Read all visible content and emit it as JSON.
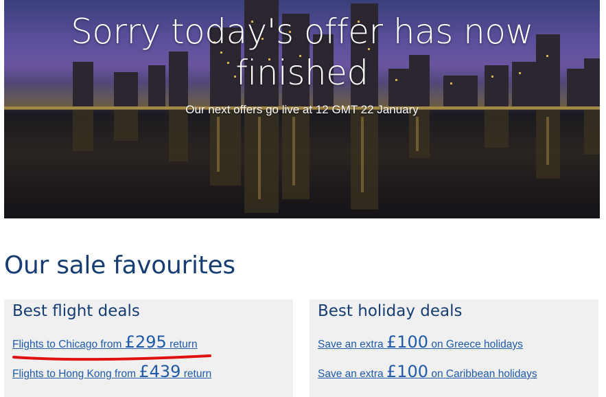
{
  "hero": {
    "title": "Sorry today's offer has now finished",
    "subtitle": "Our next offers go live at 12 GMT 22 January"
  },
  "section": {
    "title": "Our sale favourites"
  },
  "cards": {
    "flight": {
      "title": "Best flight deals",
      "deals": [
        {
          "prefix": "Flights to Chicago from ",
          "price": "£295",
          "suffix": " return"
        },
        {
          "prefix": "Flights to Hong Kong from ",
          "price": "£439",
          "suffix": " return"
        }
      ]
    },
    "holiday": {
      "title": "Best holiday deals",
      "deals": [
        {
          "prefix": "Save an extra ",
          "price": "£100",
          "suffix": " on Greece holidays"
        },
        {
          "prefix": "Save an extra ",
          "price": "£100",
          "suffix": " on Caribbean holidays"
        }
      ]
    }
  },
  "colors": {
    "heading": "#163e72",
    "link": "#1e5aa8",
    "card_bg": "#f0f0f0",
    "annotation": "#e01010"
  }
}
